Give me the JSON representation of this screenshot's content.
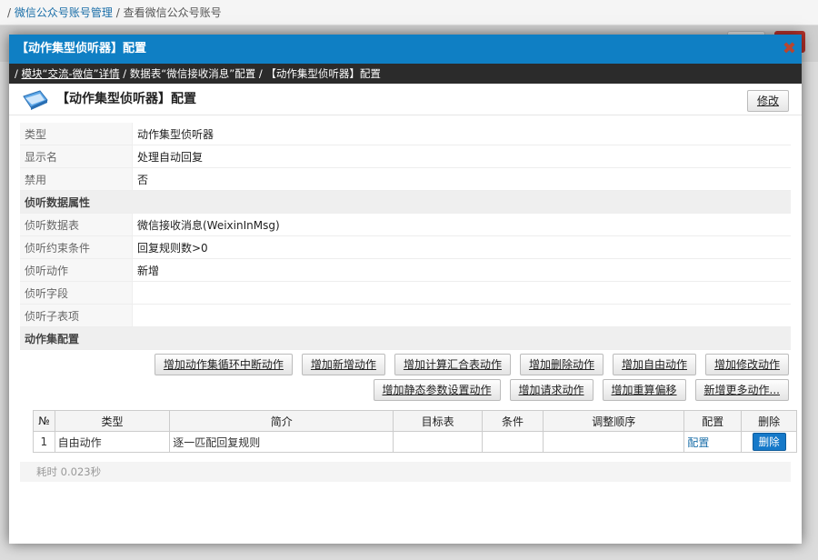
{
  "background": {
    "breadcrumb_sep": "/",
    "breadcrumb_link": "微信公众号账号管理",
    "breadcrumb_current": "查看微信公众号账号"
  },
  "modal": {
    "title": "【动作集型侦听器】配置",
    "close_icon": "close-icon",
    "crumbs": {
      "lead": "/",
      "link": "模块“交流-微信”详情",
      "mid": "/ 数据表“微信接收消息”配置 /",
      "current": "【动作集型侦听器】配置"
    },
    "heading": "【动作集型侦听器】配置",
    "edit_label": "修改"
  },
  "props": {
    "type_label": "类型",
    "type_value": "动作集型侦听器",
    "display_label": "显示名",
    "display_value": "处理自动回复",
    "disabled_label": "禁用",
    "disabled_value": "否",
    "section_listen": "侦听数据属性",
    "table_label": "侦听数据表",
    "table_value": "微信接收消息(WeixinInMsg)",
    "cond_label": "侦听约束条件",
    "cond_value": "回复规则数>0",
    "action_label": "侦听动作",
    "action_value": "新增",
    "field_label": "侦听字段",
    "field_value": "",
    "subitem_label": "侦听子表项",
    "subitem_value": "",
    "section_actions": "动作集配置"
  },
  "buttons": {
    "row1": [
      "增加动作集循环中断动作",
      "增加新增动作",
      "增加计算汇合表动作",
      "增加删除动作",
      "增加自由动作",
      "增加修改动作"
    ],
    "row2": [
      "增加静态参数设置动作",
      "增加请求动作",
      "增加重算偏移",
      "新增更多动作..."
    ]
  },
  "grid": {
    "headers": [
      "№",
      "类型",
      "简介",
      "目标表",
      "条件",
      "调整顺序",
      "配置",
      "删除"
    ],
    "rows": [
      {
        "no": "1",
        "type": "自由动作",
        "desc": "逐一匹配回复规则",
        "target": "",
        "cond": "",
        "order": "",
        "config": "配置",
        "delete": "删除"
      }
    ]
  },
  "footer": {
    "elapsed": "耗时 0.023秒"
  }
}
